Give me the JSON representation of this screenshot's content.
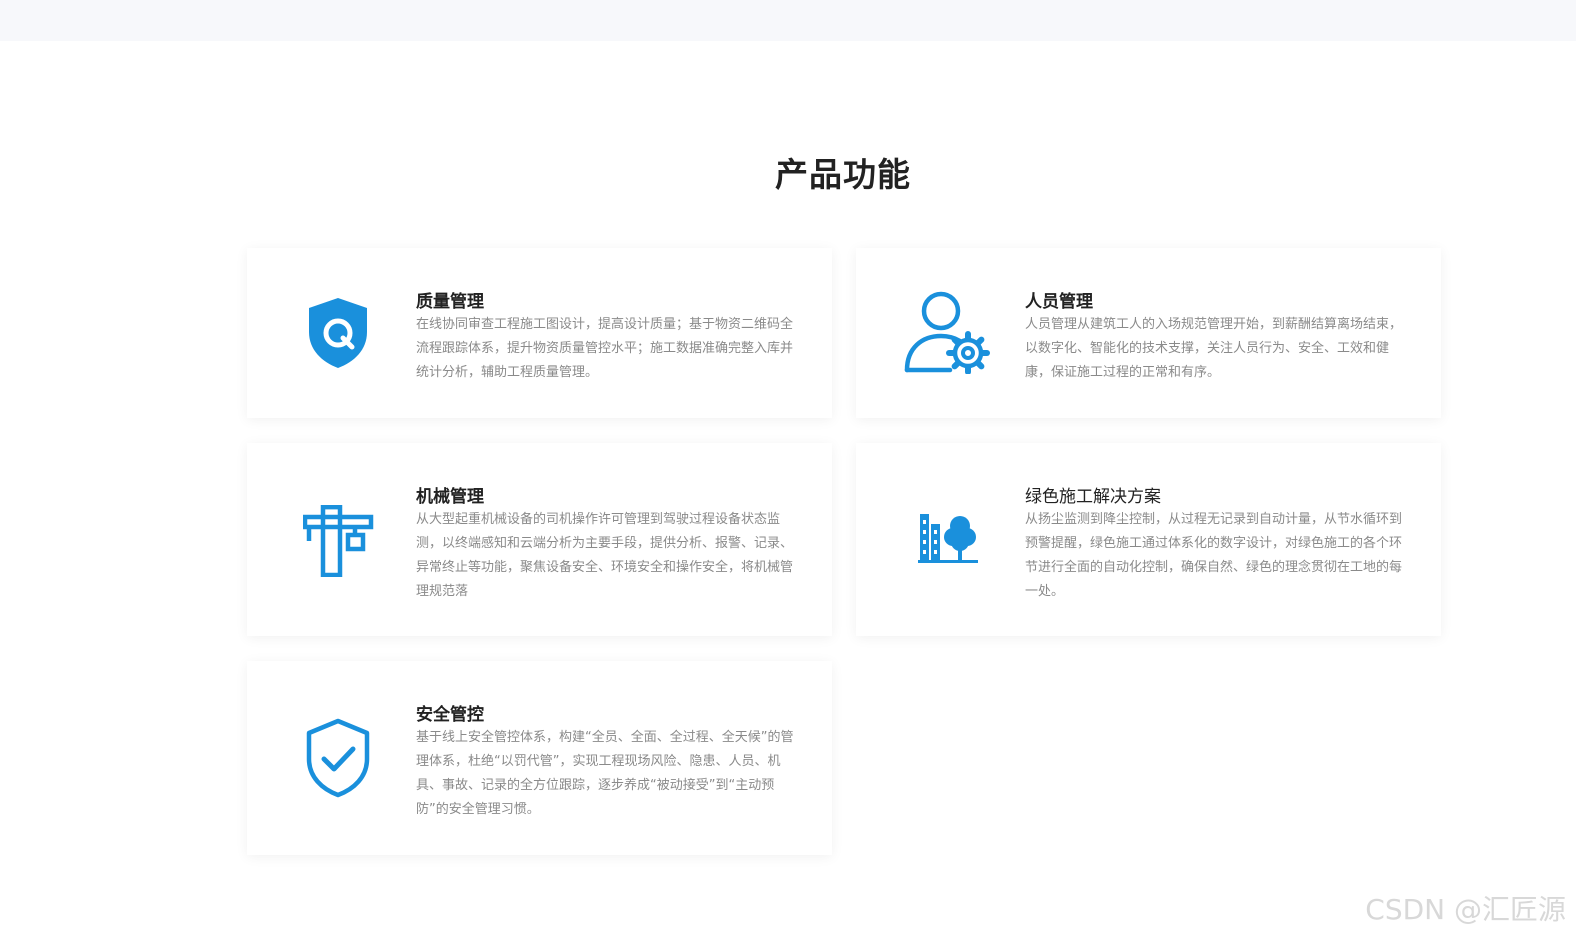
{
  "section": {
    "title": "产品功能"
  },
  "accent_color": "#1a90dc",
  "cards": [
    {
      "icon": "shield-q-icon",
      "title": "质量管理",
      "desc": "在线协同审查工程施工图设计，提高设计质量；基于物资二维码全流程跟踪体系，提升物资质量管控水平；施工数据准确完整入库并统计分析，辅助工程质量管理。"
    },
    {
      "icon": "person-gear-icon",
      "title": "人员管理",
      "desc": "人员管理从建筑工人的入场规范管理开始，到薪酬结算离场结束，以数字化、智能化的技术支撑，关注人员行为、安全、工效和健康，保证施工过程的正常和有序。"
    },
    {
      "icon": "crane-icon",
      "title": "机械管理",
      "desc": "从大型起重机械设备的司机操作许可管理到驾驶过程设备状态监测，以终端感知和云端分析为主要手段，提供分析、报警、记录、异常终止等功能，聚焦设备安全、环境安全和操作安全，将机械管理规范落"
    },
    {
      "icon": "green-building-tree-icon",
      "title": "绿色施工解决方案",
      "desc": "从扬尘监测到降尘控制，从过程无记录到自动计量，从节水循环到预警提醒，绿色施工通过体系化的数字设计，对绿色施工的各个环节进行全面的自动化控制，确保自然、绿色的理念贯彻在工地的每一处。"
    },
    {
      "icon": "shield-check-icon",
      "title": "安全管控",
      "desc": "基于线上安全管控体系，构建“全员、全面、全过程、全天候”的管理体系，杜绝“以罚代管”，实现工程现场风险、隐患、人员、机具、事故、记录的全方位跟踪，逐步养成“被动接受”到“主动预防”的安全管理习惯。"
    }
  ],
  "watermark": "CSDN @汇匠源"
}
